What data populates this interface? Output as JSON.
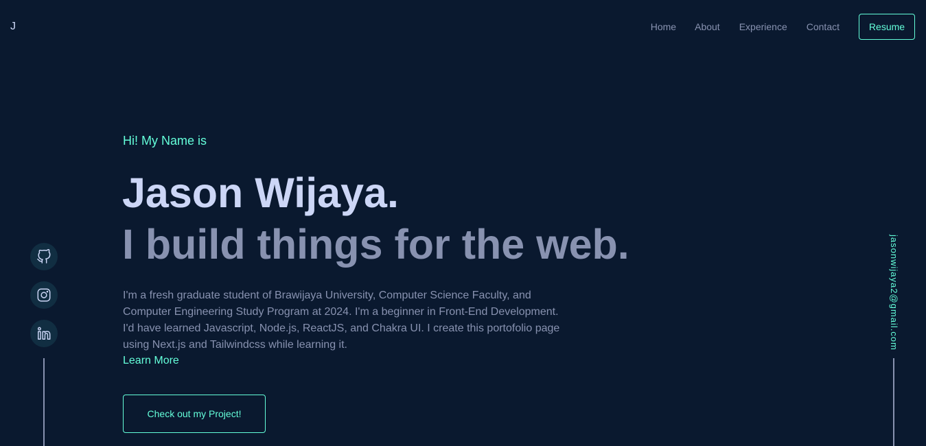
{
  "header": {
    "logo": "J",
    "nav": [
      "Home",
      "About",
      "Experience",
      "Contact"
    ],
    "resume_label": "Resume"
  },
  "hero": {
    "greeting": "Hi! My Name is",
    "name": "Jason Wijaya.",
    "tagline": "I build things for the web.",
    "bio_lines": [
      "I'm a fresh graduate student of Brawijaya University, Computer Science Faculty, and",
      "Computer Engineering Study Program at 2024. I'm a beginner in Front-End Development.",
      "I'd have learned Javascript, Node.js, ReactJS, and Chakra UI. I create this portofolio page",
      "using Next.js and Tailwindcss while learning it."
    ],
    "learn_more": "Learn More",
    "project_button": "Check out my Project!"
  },
  "socials": [
    {
      "icon": "github-icon"
    },
    {
      "icon": "instagram-icon"
    },
    {
      "icon": "linkedin-icon"
    }
  ],
  "email": "jasonwijaya2@gmail.com",
  "colors": {
    "background": "#0a192f",
    "accent": "#64ffda",
    "heading": "#ccd6f6",
    "text": "#8892b0",
    "social_bg": "#112e42"
  }
}
